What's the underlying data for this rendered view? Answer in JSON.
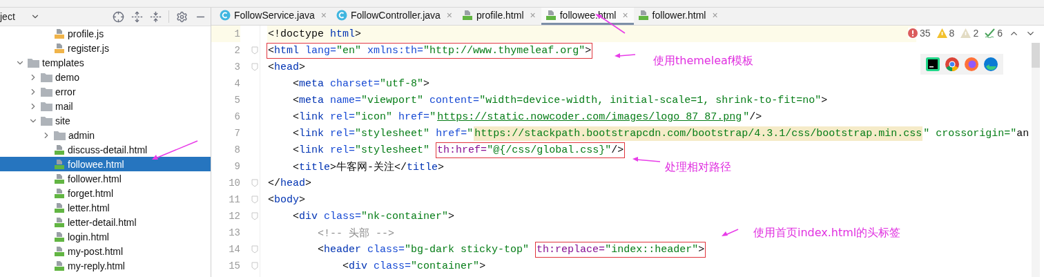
{
  "sidebar": {
    "title": "ject",
    "scrolled_files": [
      {
        "label": "profile.js",
        "kind": "js",
        "selected": false
      },
      {
        "label": "register.js",
        "kind": "js",
        "selected": false
      }
    ],
    "tree": [
      {
        "label": "templates",
        "kind": "folder",
        "expanded": true,
        "selected": false,
        "children": [
          {
            "label": "demo",
            "kind": "folder",
            "expanded": false,
            "selected": false
          },
          {
            "label": "error",
            "kind": "folder",
            "expanded": false,
            "selected": false
          },
          {
            "label": "mail",
            "kind": "folder",
            "expanded": false,
            "selected": false
          },
          {
            "label": "site",
            "kind": "folder",
            "expanded": true,
            "selected": false,
            "children": [
              {
                "label": "admin",
                "kind": "folder",
                "expanded": false,
                "selected": false
              },
              {
                "label": "discuss-detail.html",
                "kind": "html",
                "selected": false
              },
              {
                "label": "followee.html",
                "kind": "html",
                "selected": true
              },
              {
                "label": "follower.html",
                "kind": "html",
                "selected": false
              },
              {
                "label": "forget.html",
                "kind": "html",
                "selected": false
              },
              {
                "label": "letter.html",
                "kind": "html",
                "selected": false
              },
              {
                "label": "letter-detail.html",
                "kind": "html",
                "selected": false
              },
              {
                "label": "login.html",
                "kind": "html",
                "selected": false
              },
              {
                "label": "my-post.html",
                "kind": "html",
                "selected": false
              },
              {
                "label": "my-reply.html",
                "kind": "html",
                "selected": false
              }
            ]
          }
        ]
      }
    ]
  },
  "tabs": [
    {
      "label": "FollowService.java",
      "kind": "java",
      "selected": false
    },
    {
      "label": "FollowController.java",
      "kind": "java",
      "selected": false
    },
    {
      "label": "profile.html",
      "kind": "html",
      "selected": false
    },
    {
      "label": "followee.html",
      "kind": "html",
      "selected": true
    },
    {
      "label": "follower.html",
      "kind": "html",
      "selected": false
    }
  ],
  "close_glyph": "×",
  "inspections": [
    {
      "kind": "error",
      "count": "35"
    },
    {
      "kind": "warning",
      "count": "8"
    },
    {
      "kind": "weak",
      "count": "2"
    },
    {
      "kind": "typo",
      "count": "6"
    }
  ],
  "lines": [
    {
      "number": "1",
      "current": true,
      "fold": false,
      "segments": [
        {
          "text": "<!doctype html>",
          "kind": "code",
          "boxed": false
        }
      ]
    },
    {
      "number": "2",
      "current": false,
      "fold": true,
      "segments": [
        {
          "text": "<html lang=\"en\" xmlns:th=\"http://www.thymeleaf.org\">",
          "kind": "code",
          "boxed": true
        }
      ]
    },
    {
      "number": "3",
      "current": false,
      "fold": true,
      "segments": [
        {
          "text": "<head>",
          "kind": "code",
          "boxed": false
        }
      ]
    },
    {
      "number": "4",
      "current": false,
      "fold": false,
      "segments": [
        {
          "text": "    <meta charset=\"utf-8\">",
          "kind": "code",
          "boxed": false
        }
      ]
    },
    {
      "number": "5",
      "current": false,
      "fold": false,
      "segments": [
        {
          "text": "    <meta name=\"viewport\" content=\"width=device-width, initial-scale=1, shrink-to-fit=no\">",
          "kind": "code",
          "boxed": false
        }
      ]
    },
    {
      "number": "6",
      "current": false,
      "fold": false,
      "segments": [
        {
          "text": "    <link rel=\"icon\" href=\"",
          "kind": "code",
          "boxed": false
        },
        {
          "text": "https://static.nowcoder.com/images/logo_87_87.png",
          "kind": "link",
          "boxed": false
        },
        {
          "text": "\"/>",
          "kind": "code",
          "boxed": false
        }
      ]
    },
    {
      "number": "7",
      "current": false,
      "fold": false,
      "segments": [
        {
          "text": "    <link rel=\"stylesheet\" href=\"",
          "kind": "code",
          "boxed": false
        },
        {
          "text": "https://stackpath.bootstrapcdn.com/bootstrap/4.3.1/css/bootstrap.min.css",
          "kind": "marked",
          "boxed": false
        },
        {
          "text": "\" crossorigin=\"an",
          "kind": "code",
          "boxed": false
        }
      ]
    },
    {
      "number": "8",
      "current": false,
      "fold": false,
      "segments": [
        {
          "text": "    <link rel=\"stylesheet\"",
          "kind": "code",
          "boxed": false
        },
        {
          "text": "th:href=\"@{/css/global.css}\"/>",
          "kind": "code",
          "boxed": true
        }
      ]
    },
    {
      "number": "9",
      "current": false,
      "fold": false,
      "segments": [
        {
          "text": "    <title>牛客网-关注</title>",
          "kind": "code",
          "boxed": false
        }
      ]
    },
    {
      "number": "10",
      "current": false,
      "fold": true,
      "segments": [
        {
          "text": "</head>",
          "kind": "code",
          "boxed": false
        }
      ]
    },
    {
      "number": "11",
      "current": false,
      "fold": true,
      "segments": [
        {
          "text": "<body>",
          "kind": "code",
          "boxed": false
        }
      ]
    },
    {
      "number": "12",
      "current": false,
      "fold": true,
      "segments": [
        {
          "text": "    <div class=\"nk-container\">",
          "kind": "code",
          "boxed": false
        }
      ]
    },
    {
      "number": "13",
      "current": false,
      "fold": false,
      "segments": [
        {
          "text": "        <!-- 头部 -->",
          "kind": "code",
          "boxed": false
        }
      ]
    },
    {
      "number": "14",
      "current": false,
      "fold": true,
      "segments": [
        {
          "text": "        <header class=\"bg-dark sticky-top\"",
          "kind": "code",
          "boxed": false
        },
        {
          "text": "th:replace=\"index::header\">",
          "kind": "code",
          "boxed": true
        }
      ]
    },
    {
      "number": "15",
      "current": false,
      "fold": true,
      "segments": [
        {
          "text": "            <div class=\"container\">",
          "kind": "code",
          "boxed": false
        }
      ]
    }
  ],
  "annotations": [
    "使用themeleaf模板",
    "处理相对路径",
    "使用首页index.html的头标签"
  ]
}
